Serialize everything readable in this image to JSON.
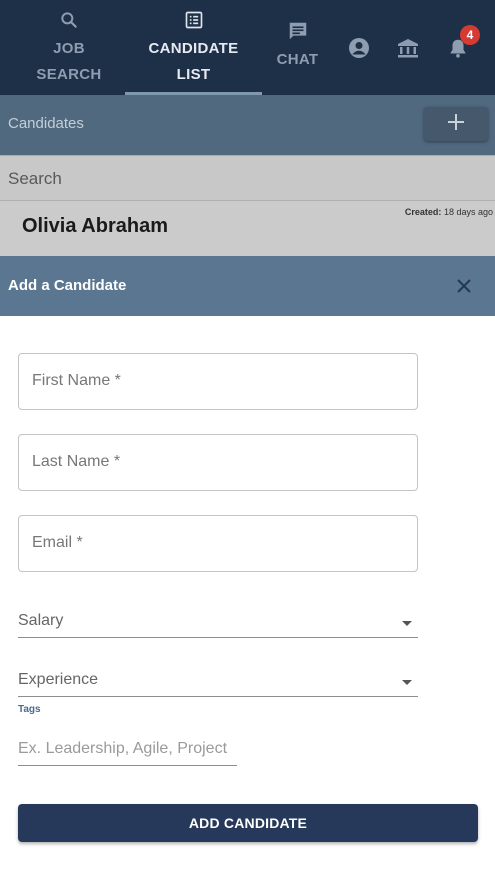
{
  "nav": {
    "tabs": [
      {
        "label_line1": "JOB",
        "label_line2": "SEARCH",
        "icon": "search-icon",
        "active": false
      },
      {
        "label_line1": "CANDIDATE",
        "label_line2": "LIST",
        "icon": "list-icon",
        "active": true
      },
      {
        "label_line1": "CHAT",
        "icon": "chat-icon",
        "active": false
      }
    ],
    "icons": [
      "account-circle-icon",
      "bank-icon",
      "bell-icon"
    ],
    "notification_count": "4",
    "colors": {
      "bar": "#1e2f48",
      "active_text": "#e6ebf1",
      "inactive_text": "#8e9db0",
      "badge": "#d63a32"
    }
  },
  "list": {
    "title": "Candidates",
    "add_icon": "plus-icon",
    "search_placeholder": "Search",
    "candidate": {
      "name": "Olivia Abraham",
      "created_label": "Created:",
      "created_value": "18 days ago"
    }
  },
  "modal": {
    "title": "Add a Candidate",
    "close_icon": "close-icon",
    "fields": {
      "first_name": "First Name *",
      "last_name": "Last Name *",
      "email": "Email *"
    },
    "salary": {
      "placeholder": "Salary",
      "icon": "dropdown-arrow-icon"
    },
    "experience": {
      "placeholder": "Experience",
      "icon": "dropdown-arrow-icon"
    },
    "tags": {
      "label": "Tags",
      "placeholder": "Ex. Leadership, Agile, Project"
    },
    "submit_label": "ADD CANDIDATE",
    "colors": {
      "header": "#5b7690",
      "button": "#26395a"
    }
  }
}
